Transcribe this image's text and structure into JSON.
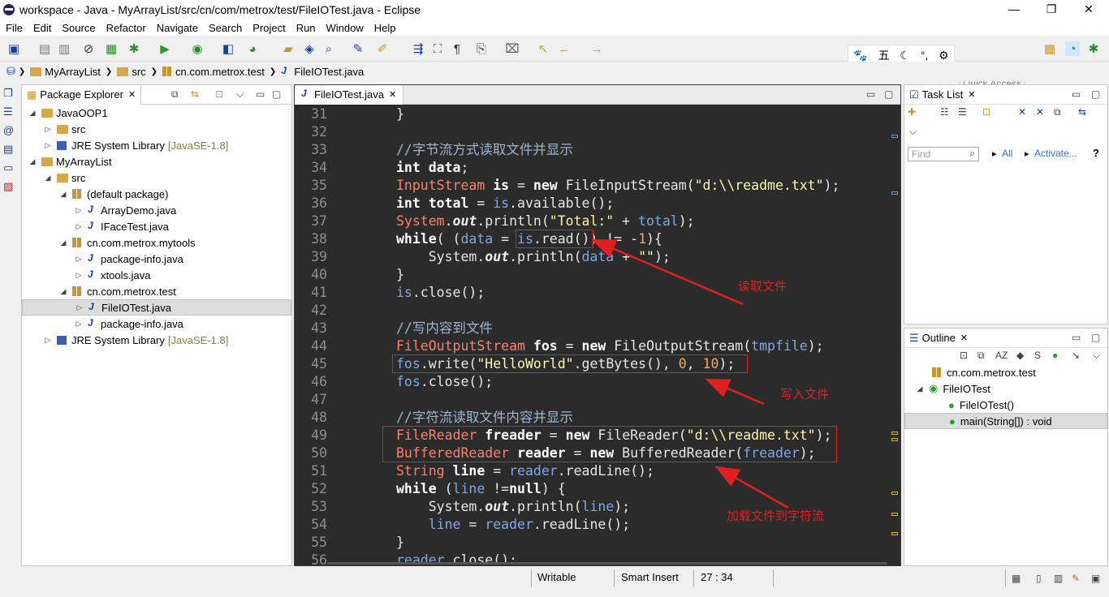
{
  "window": {
    "title": "workspace - Java - MyArrayList/src/cn/com/metrox/test/FileIOTest.java - Eclipse",
    "min": "—",
    "max": "❐",
    "close": "✕"
  },
  "menu": [
    "File",
    "Edit",
    "Source",
    "Refactor",
    "Navigate",
    "Search",
    "Project",
    "Run",
    "Window",
    "Help"
  ],
  "quick_access": {
    "placeholder": "Quick Access"
  },
  "ime": {
    "items": [
      "🐾",
      "五",
      "☾",
      "°,",
      "⚙"
    ]
  },
  "breadcrumb": [
    "MyArrayList",
    "src",
    "cn.com.metrox.test",
    "FileIOTest.java"
  ],
  "package_explorer": {
    "title": "Package Explorer",
    "tree": [
      {
        "label": "JavaOOP1",
        "extra": "",
        "depth": 0,
        "tw": "◢",
        "icon": "project"
      },
      {
        "label": "src",
        "extra": "",
        "depth": 1,
        "tw": "▷",
        "icon": "srcfolder"
      },
      {
        "label": "JRE System Library",
        "extra": "[JavaSE-1.8]",
        "depth": 1,
        "tw": "▷",
        "icon": "library"
      },
      {
        "label": "MyArrayList",
        "extra": "",
        "depth": 0,
        "tw": "◢",
        "icon": "project"
      },
      {
        "label": "src",
        "extra": "",
        "depth": 1,
        "tw": "◢",
        "icon": "srcfolder"
      },
      {
        "label": "(default package)",
        "extra": "",
        "depth": 2,
        "tw": "◢",
        "icon": "package"
      },
      {
        "label": "ArrayDemo.java",
        "extra": "",
        "depth": 3,
        "tw": "▷",
        "icon": "java"
      },
      {
        "label": "IFaceTest.java",
        "extra": "",
        "depth": 3,
        "tw": "▷",
        "icon": "java"
      },
      {
        "label": "cn.com.metrox.mytools",
        "extra": "",
        "depth": 2,
        "tw": "◢",
        "icon": "package"
      },
      {
        "label": "package-info.java",
        "extra": "",
        "depth": 3,
        "tw": "▷",
        "icon": "java"
      },
      {
        "label": "xtools.java",
        "extra": "",
        "depth": 3,
        "tw": "▷",
        "icon": "java"
      },
      {
        "label": "cn.com.metrox.test",
        "extra": "",
        "depth": 2,
        "tw": "◢",
        "icon": "package"
      },
      {
        "label": "FileIOTest.java",
        "extra": "",
        "depth": 3,
        "tw": "▷",
        "icon": "java",
        "selected": true
      },
      {
        "label": "package-info.java",
        "extra": "",
        "depth": 3,
        "tw": "▷",
        "icon": "java"
      },
      {
        "label": "JRE System Library",
        "extra": "[JavaSE-1.8]",
        "depth": 1,
        "tw": "▷",
        "icon": "library"
      }
    ]
  },
  "editor": {
    "tab": "FileIOTest.java",
    "line_numbers": [
      "31",
      "32",
      "33",
      "34",
      "35",
      "36",
      "37",
      "38",
      "39",
      "40",
      "41",
      "42",
      "43",
      "44",
      "45",
      "46",
      "47",
      "48",
      "49",
      "50",
      "51",
      "52",
      "53",
      "54",
      "55",
      "56"
    ],
    "lines": [
      [
        [
          "p",
          "}"
        ]
      ],
      [],
      [
        [
          "cm",
          "//字节流方式读取文件并显示"
        ]
      ],
      [
        [
          "kw",
          "int"
        ],
        [
          "p",
          " "
        ],
        [
          "kw",
          "data"
        ],
        [
          "p",
          ";"
        ]
      ],
      [
        [
          "ty",
          "InputStream"
        ],
        [
          "p",
          " "
        ],
        [
          "kw",
          "is"
        ],
        [
          "p",
          " = "
        ],
        [
          "kw",
          "new"
        ],
        [
          "p",
          " FileInputStream("
        ],
        [
          "st",
          "\"d:\\\\readme.txt\""
        ],
        [
          "p",
          ");"
        ]
      ],
      [
        [
          "kw",
          "int"
        ],
        [
          "p",
          " "
        ],
        [
          "kw",
          "total"
        ],
        [
          "p",
          " = "
        ],
        [
          "vr",
          "is"
        ],
        [
          "p",
          ".available();"
        ]
      ],
      [
        [
          "ty",
          "System"
        ],
        [
          "p",
          "."
        ],
        [
          "fld",
          "out"
        ],
        [
          "p",
          ".println("
        ],
        [
          "st",
          "\"Total:\""
        ],
        [
          "p",
          " + "
        ],
        [
          "vr",
          "total"
        ],
        [
          "p",
          ");"
        ]
      ],
      [
        [
          "kw",
          "while"
        ],
        [
          "p",
          "( ("
        ],
        [
          "vr",
          "data"
        ],
        [
          "p",
          " = "
        ],
        [
          "vr",
          "is"
        ],
        [
          "p",
          ".read()) != -"
        ],
        [
          "nm",
          "1"
        ],
        [
          "p",
          "){"
        ]
      ],
      [
        [
          "p",
          "    System."
        ],
        [
          "fld",
          "out"
        ],
        [
          "p",
          ".println("
        ],
        [
          "vr",
          "data"
        ],
        [
          "p",
          " + "
        ],
        [
          "st",
          "\"\""
        ],
        [
          "p",
          ");"
        ]
      ],
      [
        [
          "p",
          "}"
        ]
      ],
      [
        [
          "vr",
          "is"
        ],
        [
          "p",
          ".close();"
        ]
      ],
      [],
      [
        [
          "cm",
          "//写内容到文件"
        ]
      ],
      [
        [
          "ty",
          "FileOutputStream"
        ],
        [
          "p",
          " "
        ],
        [
          "kw",
          "fos"
        ],
        [
          "p",
          " = "
        ],
        [
          "kw",
          "new"
        ],
        [
          "p",
          " FileOutputStream("
        ],
        [
          "vr",
          "tmpfile"
        ],
        [
          "p",
          ");"
        ]
      ],
      [
        [
          "vr",
          "fos"
        ],
        [
          "p",
          ".write("
        ],
        [
          "st",
          "\"HelloWorld\""
        ],
        [
          "p",
          ".getBytes(), "
        ],
        [
          "nm",
          "0"
        ],
        [
          "p",
          ", "
        ],
        [
          "nm",
          "10"
        ],
        [
          "p",
          ");"
        ]
      ],
      [
        [
          "vr",
          "fos"
        ],
        [
          "p",
          ".close();"
        ]
      ],
      [],
      [
        [
          "cm",
          "//字符流读取文件内容并显示"
        ]
      ],
      [
        [
          "ty",
          "FileReader"
        ],
        [
          "p",
          " "
        ],
        [
          "kw",
          "freader"
        ],
        [
          "p",
          " = "
        ],
        [
          "kw",
          "new"
        ],
        [
          "p",
          " FileReader("
        ],
        [
          "st",
          "\"d:\\\\readme.txt\""
        ],
        [
          "p",
          ");"
        ]
      ],
      [
        [
          "ty",
          "BufferedReader"
        ],
        [
          "p",
          " "
        ],
        [
          "kw",
          "reader"
        ],
        [
          "p",
          " = "
        ],
        [
          "kw",
          "new"
        ],
        [
          "p",
          " BufferedReader("
        ],
        [
          "vr",
          "freader"
        ],
        [
          "p",
          ");"
        ]
      ],
      [
        [
          "ty",
          "String"
        ],
        [
          "p",
          " "
        ],
        [
          "kw",
          "line"
        ],
        [
          "p",
          " = "
        ],
        [
          "vr",
          "reader"
        ],
        [
          "p",
          ".readLine();"
        ]
      ],
      [
        [
          "kw",
          "while"
        ],
        [
          "p",
          " ("
        ],
        [
          "vr",
          "line"
        ],
        [
          "p",
          " !="
        ],
        [
          "kw",
          "null"
        ],
        [
          "p",
          ") {"
        ]
      ],
      [
        [
          "p",
          "    System."
        ],
        [
          "fld",
          "out"
        ],
        [
          "p",
          ".println("
        ],
        [
          "vr",
          "line"
        ],
        [
          "p",
          ");"
        ]
      ],
      [
        [
          "p",
          "    "
        ],
        [
          "vr",
          "line"
        ],
        [
          "p",
          " = "
        ],
        [
          "vr",
          "reader"
        ],
        [
          "p",
          ".readLine();"
        ]
      ],
      [
        [
          "p",
          "}"
        ]
      ],
      [
        [
          "vr",
          "reader"
        ],
        [
          "p",
          ".close();"
        ]
      ]
    ]
  },
  "annotations": {
    "read": "读取文件",
    "write": "写入文件",
    "load": "加载文件到字符流"
  },
  "task_list": {
    "title": "Task List",
    "find_placeholder": "Find",
    "all": "All",
    "activate": "Activate..."
  },
  "outline": {
    "title": "Outline",
    "items": [
      {
        "label": "cn.com.metrox.test",
        "depth": 0
      },
      {
        "label": "FileIOTest",
        "depth": 0
      },
      {
        "label": "FileIOTest()",
        "depth": 1
      },
      {
        "label": "main(String[]) : void",
        "depth": 1,
        "selected": true
      }
    ]
  },
  "status": {
    "writable": "Writable",
    "insert": "Smart Insert",
    "position": "27 : 34"
  },
  "colors": {
    "editor_bg": "#2b2b2b",
    "annotation": "#e02020",
    "keyword": "#ffffff",
    "type": "#ff7f6b",
    "variable": "#7ca8e6",
    "string": "#fff5a6",
    "comment": "#9fb3cc"
  }
}
